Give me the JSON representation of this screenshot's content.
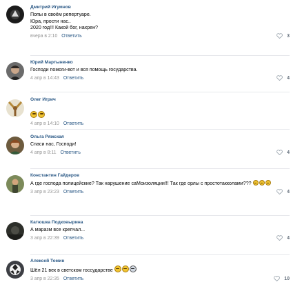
{
  "comments": [
    {
      "author": "Дмитрий Игумнов",
      "text": "Попы в своём репертуаре.\nЮра, прости нас..\n2020 год!!! Какой бог, нахрен?",
      "date": "вчера в 2:10",
      "reply": "Ответить",
      "likes": "3",
      "avatar_icon": "round-black-logo-avatar"
    },
    {
      "author": "Юрий Мартыненко",
      "text": "Господи помоги-вот и вся помощь государства.",
      "date": "4 апр в 14:43",
      "reply": "Ответить",
      "likes": "4",
      "avatar_icon": "man-face-avatar"
    },
    {
      "author": "Олег Игрич",
      "text": "",
      "date": "4 апр в 14:10",
      "reply": "Ответить",
      "likes": "",
      "avatar_icon": "athlete-arms-raised-avatar"
    },
    {
      "author": "Ольга Ряжская",
      "text": "Спаси нас, Господи!",
      "date": "4 апр в 8:11",
      "reply": "Ответить",
      "likes": "4",
      "avatar_icon": "woman-photo-avatar"
    },
    {
      "author": "Константин Гайдеров",
      "text": "А где господа полицейские? Так нарушение саМоизоляции!!! Так где орлы с простотакколами???",
      "date": "3 апр в 23:23",
      "reply": "Ответить",
      "likes": "4",
      "avatar_icon": "man-outdoors-avatar"
    },
    {
      "author": "Катюшка Подковырина",
      "text": "А маразм все крепчал...",
      "date": "3 апр в 22:39",
      "reply": "Ответить",
      "likes": "4",
      "avatar_icon": "dark-photo-avatar"
    },
    {
      "author": "Алексей Томин",
      "text": "Шёл 21 век в светском госсударстве",
      "date": "3 апр в 22:35",
      "reply": "Ответить",
      "likes": "10",
      "avatar_icon": "ball-avatar"
    }
  ],
  "icons": {
    "like": "heart-icon",
    "emoji": "emoji-face-icon"
  },
  "colors": {
    "author": "#2a5885",
    "meta": "#939393",
    "divider": "#e7e8ec"
  }
}
